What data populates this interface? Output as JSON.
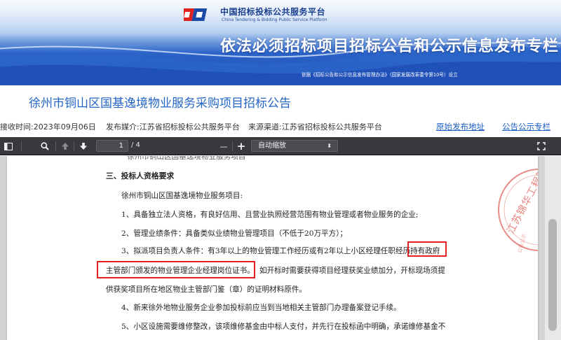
{
  "banner": {
    "platform_name_cn": "中国招标投标公共服务平台",
    "platform_name_en": "China Tendering & Bidding Public Service Platform",
    "slogan": "依法必须招标项目招标公告和公示信息发布专栏",
    "basis": "依据《招标公告和公示信息发布管理办法》（国家发展改革委令第10号）设立",
    "colors": {
      "banner_blue": "#2b63c9",
      "logo_red": "#e0231f",
      "logo_blue": "#1d4aa8"
    }
  },
  "notice": {
    "title": "徐州市铜山区国基逸境物业服务采购项目招标公告"
  },
  "meta": {
    "receive_time": "接收时间:2023年09月06日",
    "publish_media": "发布媒介:江苏省招标投标公共服务平台",
    "source_channel": "来源渠道:江苏省招标投标公共服务平台",
    "link_original": "原始发布地址",
    "link_column": "公告公示专栏",
    "link_color": "#1c5fc4"
  },
  "pdf_toolbar": {
    "icons": [
      "sidebar-toggle-icon",
      "search-icon",
      "previous-page-icon",
      "next-page-icon",
      "zoom-out-icon",
      "zoom-in-icon",
      "presentation-mode-icon"
    ],
    "current_page": "1",
    "total_pages": "/ 4",
    "zoom_out_label": "—",
    "zoom_in_label": "+",
    "zoom_level": "自动缩放"
  },
  "document": {
    "cut_line": "徐州市铜山区国基逸境物业服务项目",
    "section_heading": "三、投标人资格要求",
    "project_line": "徐州市铜山区国基逸境物业服务项目:",
    "req1": "1、具备独立法人资格，有良好信用、且营业执照经营范围有物业管理或者物业服务的企业;",
    "req2": "2、管理业绩条件：具备类似业绩物业管理项目（不低于20万平方）；",
    "req3_part1": "3、拟派项目负责人条件：有3年以上的物业管理工作经历或有2年以上小区经理任职经历;",
    "req3_highlight1": "持有政府",
    "req3_highlight2": "主管部门颁发的物业管理企业经理岗位证书。",
    "req3_part2": "如开标时需要获得项目经理获奖业绩加分，开标现场须提",
    "req3_part3": "供获奖项目所在地区物业主管部门鉴（章）的证明材料原件。",
    "req4": "4、新来徐外地物业服务企业参加投标前应当到当地相关主管部门办理备案登记手续。",
    "req5": "5、小区设施需要维修整改，该项维修基金由中标人支付，并先行在投标函中明确，承诺维修基金不",
    "stamp_text": "江苏锦华工程管",
    "stamp_text_small": "公告公示",
    "highlight_color": "#e0231f"
  }
}
